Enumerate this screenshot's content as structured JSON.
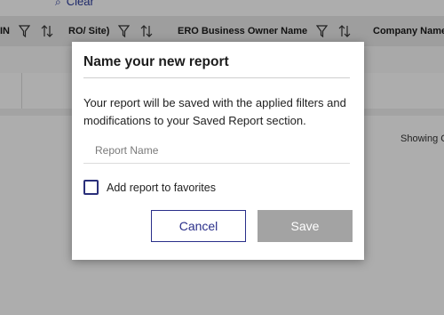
{
  "background": {
    "clear_link": "Clear",
    "columns": [
      {
        "label": "IN"
      },
      {
        "label": "RO/ Site)"
      },
      {
        "label": "ERO Business Owner Name"
      },
      {
        "label": "Company Name"
      }
    ],
    "showing_text": "Showing C"
  },
  "modal": {
    "title": "Name your new report",
    "description": "Your report will be saved with the applied filters and modifications to your Saved Report section.",
    "report_name_placeholder": "Report Name",
    "report_name_value": "",
    "favorites_label": "Add report to favorites",
    "favorites_checked": false,
    "cancel_label": "Cancel",
    "save_label": "Save"
  },
  "colors": {
    "accent": "#2a2f8a",
    "save_disabled": "#a3a3a3",
    "overlay": "rgba(0,0,0,0.32)"
  }
}
